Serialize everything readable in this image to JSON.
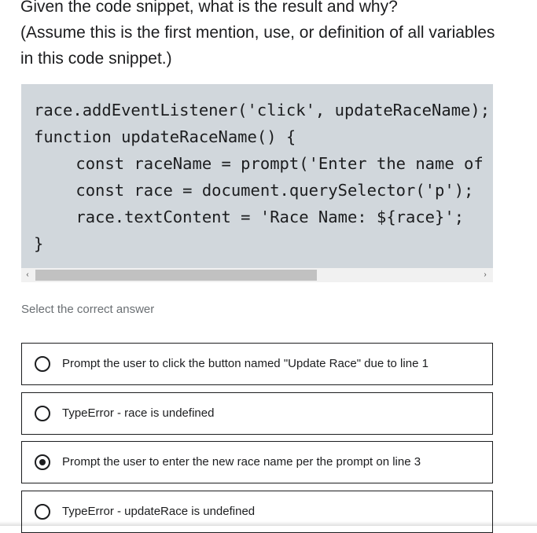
{
  "question": {
    "text": "Given the code snippet, what is the result and why?\n(Assume this is the first mention, use, or definition of all variables in this code snippet.)"
  },
  "code": {
    "lines": [
      "race.addEventListener('click', updateRaceName);",
      "function updateRaceName() {",
      "    const raceName = prompt('Enter the name of the new race');",
      "    const race = document.querySelector('p');",
      "    race.textContent = 'Race Name: ${race}';",
      "}"
    ]
  },
  "scrollbar": {
    "left_arrow": "‹",
    "right_arrow": "›",
    "thumb_fraction": 0.6
  },
  "answers": {
    "label": "Select the correct answer",
    "options": [
      {
        "text": "Prompt the user to click the button named \"Update Race\" due to line 1",
        "selected": false
      },
      {
        "text": "TypeError - race is undefined",
        "selected": false
      },
      {
        "text": "Prompt the user to enter the new race name per the prompt on line 3",
        "selected": true
      },
      {
        "text": "TypeError - updateRace is undefined",
        "selected": false
      }
    ]
  }
}
